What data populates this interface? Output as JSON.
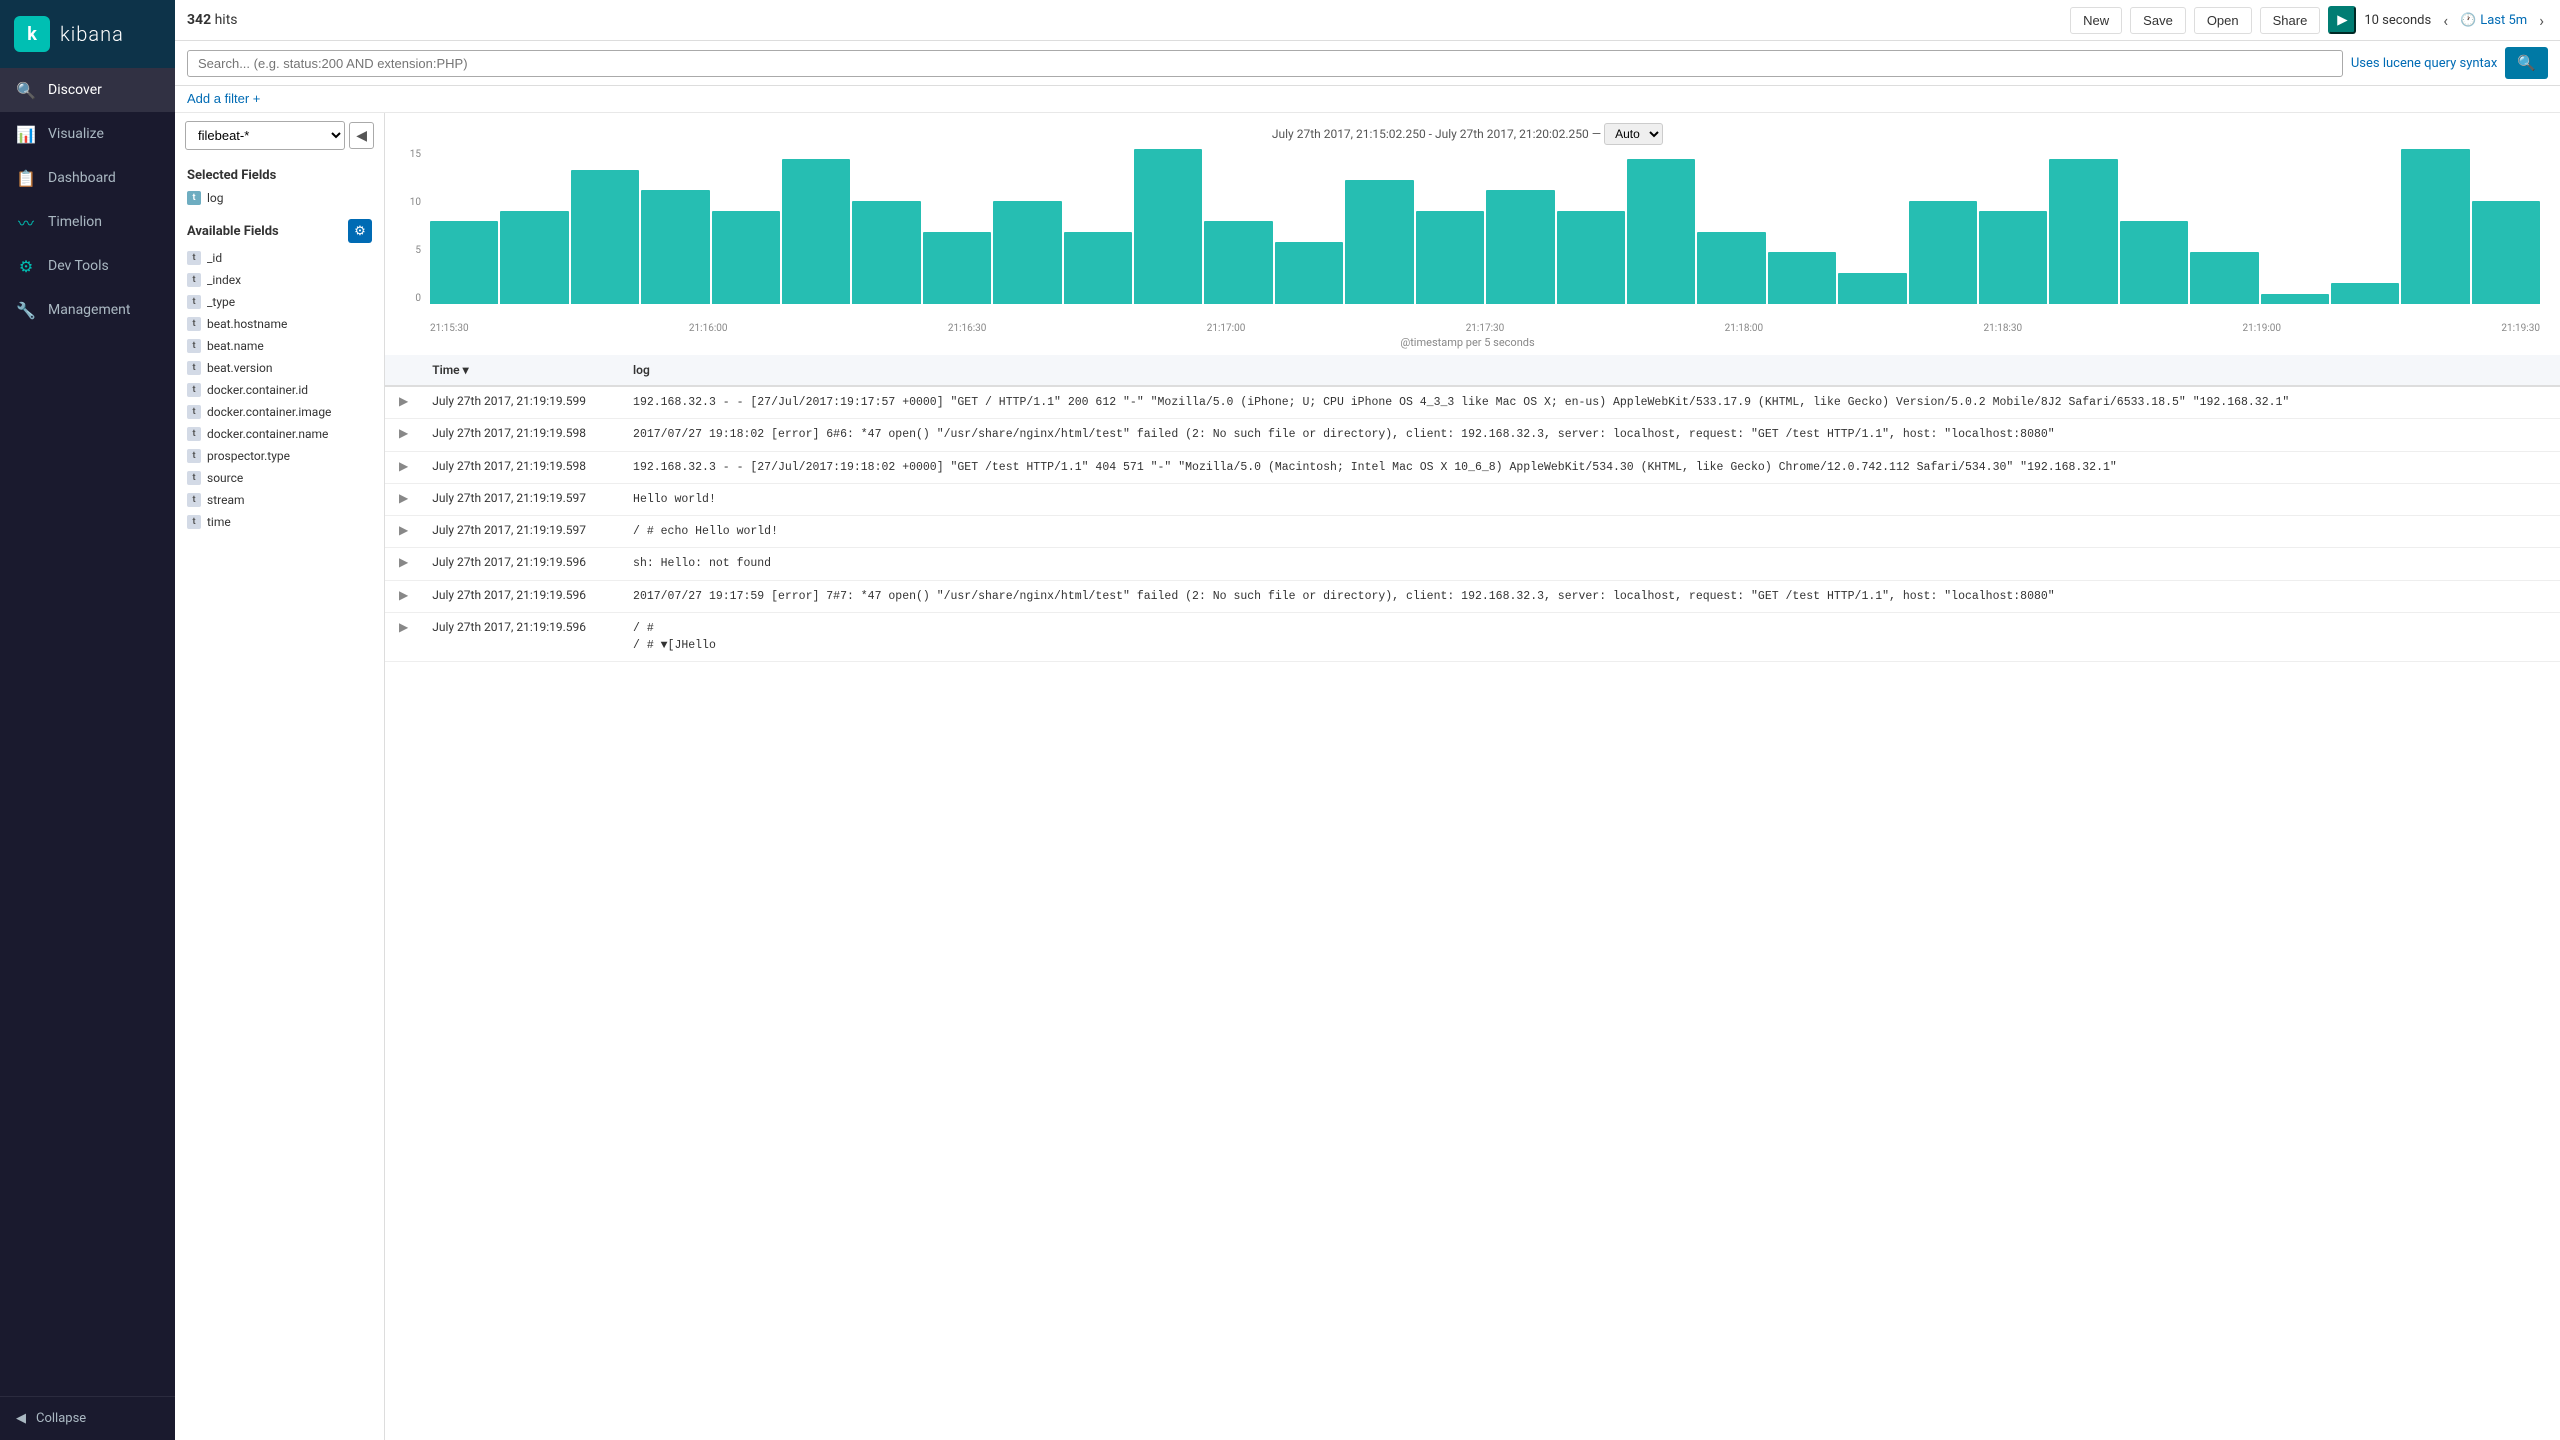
{
  "app": {
    "name": "kibana",
    "logo_letter": "k"
  },
  "nav": {
    "items": [
      {
        "id": "discover",
        "label": "Discover",
        "icon": "🔍",
        "active": true
      },
      {
        "id": "visualize",
        "label": "Visualize",
        "icon": "📊",
        "active": false
      },
      {
        "id": "dashboard",
        "label": "Dashboard",
        "icon": "📋",
        "active": false
      },
      {
        "id": "timelion",
        "label": "Timelion",
        "icon": "〰",
        "active": false
      },
      {
        "id": "dev-tools",
        "label": "Dev Tools",
        "icon": "⚙",
        "active": false
      },
      {
        "id": "management",
        "label": "Management",
        "icon": "🔧",
        "active": false
      }
    ],
    "collapse_label": "Collapse"
  },
  "topbar": {
    "hits": "342",
    "hits_label": "hits",
    "new_label": "New",
    "save_label": "Save",
    "open_label": "Open",
    "share_label": "Share",
    "interval_label": "10 seconds",
    "last_label": "Last 5m"
  },
  "search": {
    "placeholder": "Search... (e.g. status:200 AND extension:PHP)",
    "lucene_text": "Uses lucene query syntax",
    "add_filter_label": "Add a filter +"
  },
  "left_panel": {
    "index_pattern": "filebeat-*",
    "selected_fields_title": "Selected Fields",
    "selected_fields": [
      {
        "type": "t",
        "name": "log"
      }
    ],
    "available_fields_title": "Available Fields",
    "available_fields": [
      {
        "type": "t",
        "name": "_id"
      },
      {
        "type": "t",
        "name": "_index"
      },
      {
        "type": "t",
        "name": "_type"
      },
      {
        "type": "t",
        "name": "beat.hostname"
      },
      {
        "type": "t",
        "name": "beat.name"
      },
      {
        "type": "t",
        "name": "beat.version"
      },
      {
        "type": "t",
        "name": "docker.container.id"
      },
      {
        "type": "t",
        "name": "docker.container.image"
      },
      {
        "type": "t",
        "name": "docker.container.name"
      },
      {
        "type": "t",
        "name": "prospector.type"
      },
      {
        "type": "t",
        "name": "source"
      },
      {
        "type": "t",
        "name": "stream"
      },
      {
        "type": "t",
        "name": "time"
      }
    ]
  },
  "chart": {
    "title": "July 27th 2017, 21:15:02.250 - July 27th 2017, 21:20:02.250 —",
    "auto_label": "Auto",
    "y_labels": [
      "15",
      "10",
      "5",
      "0"
    ],
    "x_labels": [
      "21:15:30",
      "21:16:00",
      "21:16:30",
      "21:17:00",
      "21:17:30",
      "21:18:00",
      "21:18:30",
      "21:19:00",
      "21:19:30"
    ],
    "timestamp_label": "@timestamp per 5 seconds",
    "bars": [
      8,
      9,
      13,
      11,
      9,
      14,
      10,
      7,
      10,
      7,
      15,
      8,
      6,
      12,
      9,
      11,
      9,
      14,
      7,
      5,
      3,
      10,
      9,
      14,
      8,
      5,
      1,
      2,
      15,
      10
    ]
  },
  "table": {
    "col_time": "Time",
    "col_log": "log",
    "rows": [
      {
        "time": "July 27th 2017, 21:19:19.599",
        "log": "192.168.32.3 - - [27/Jul/2017:19:17:57 +0000] \"GET / HTTP/1.1\" 200 612 \"-\" \"Mozilla/5.0 (iPhone; U; CPU iPhone OS 4_3_3 like Mac OS X; en-us) AppleWebKit/533.17.9 (KHTML, like Gecko) Version/5.0.2 Mobile/8J2 Safari/6533.18.5\" \"192.168.32.1\"",
        "log2": null
      },
      {
        "time": "July 27th 2017, 21:19:19.598",
        "log": "2017/07/27 19:18:02 [error] 6#6: *47 open() \"/usr/share/nginx/html/test\" failed (2: No such file or directory), client: 192.168.32.3, server: localhost, request: \"GET /test HTTP/1.1\", host: \"localhost:8080\"",
        "log2": null
      },
      {
        "time": "July 27th 2017, 21:19:19.598",
        "log": "192.168.32.3 - - [27/Jul/2017:19:18:02 +0000] \"GET /test HTTP/1.1\" 404 571 \"-\" \"Mozilla/5.0 (Macintosh; Intel Mac OS X 10_6_8) AppleWebKit/534.30 (KHTML, like Gecko) Chrome/12.0.742.112 Safari/534.30\" \"192.168.32.1\"",
        "log2": null
      },
      {
        "time": "July 27th 2017, 21:19:19.597",
        "log": "Hello world!",
        "log2": null
      },
      {
        "time": "July 27th 2017, 21:19:19.597",
        "log": "/ # echo Hello world!",
        "log2": null
      },
      {
        "time": "July 27th 2017, 21:19:19.596",
        "log": "sh: Hello: not found",
        "log2": null
      },
      {
        "time": "July 27th 2017, 21:19:19.596",
        "log": "2017/07/27 19:17:59 [error] 7#7: *47 open() \"/usr/share/nginx/html/test\" failed (2: No such file or directory), client: 192.168.32.3, server: localhost, request: \"GET /test HTTP/1.1\", host: \"localhost:8080\"",
        "log2": null
      },
      {
        "time": "July 27th 2017, 21:19:19.596",
        "log": "/ #",
        "log2": "/ # ▼[JHello"
      }
    ]
  },
  "colors": {
    "sidebar_bg": "#1a1a2e",
    "accent": "#00bfb3",
    "link": "#006bb4",
    "bar": "#00b3a4"
  }
}
